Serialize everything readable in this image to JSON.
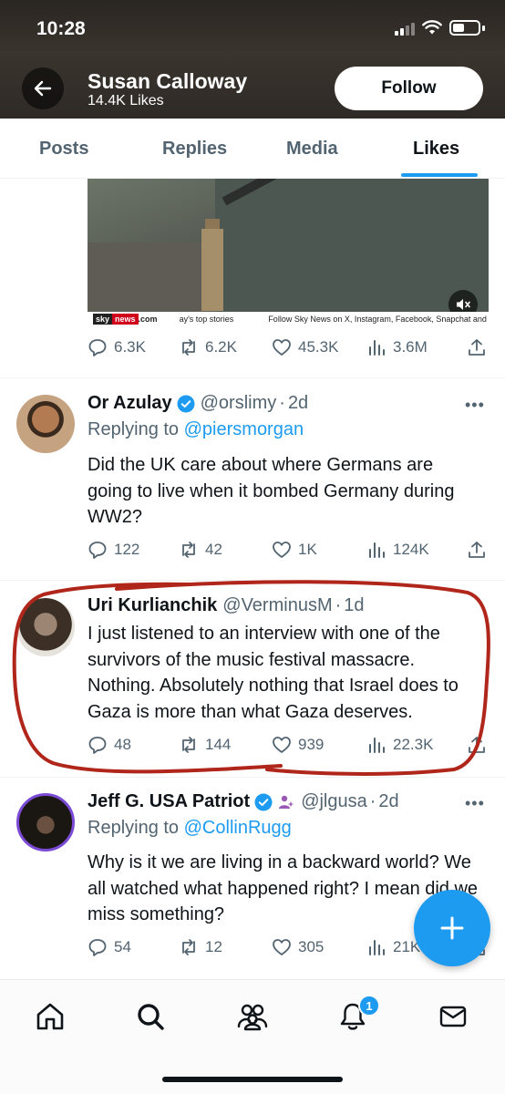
{
  "status_bar": {
    "time": "10:28"
  },
  "header": {
    "name": "Susan Calloway",
    "likes": "14.4K Likes",
    "follow_label": "Follow"
  },
  "tabs": [
    {
      "label": "Posts",
      "active": false
    },
    {
      "label": "Replies",
      "active": false
    },
    {
      "label": "Media",
      "active": false
    },
    {
      "label": "Likes",
      "active": true
    }
  ],
  "media_ticker": {
    "brand_sky": "sky",
    "brand_news": "news",
    "brand_com": ".com",
    "stories": "ay's top stories",
    "follow_text": "Follow Sky News on X, Instagram, Facebook, Snapchat and T"
  },
  "post0": {
    "stats": {
      "replies": "6.3K",
      "reposts": "6.2K",
      "likes": "45.3K",
      "views": "3.6M"
    }
  },
  "post1": {
    "name": "Or Azulay",
    "handle": "@orslimy",
    "dot": "·",
    "age": "2d",
    "replying_prefix": "Replying to",
    "replying_to": "@piersmorgan",
    "text": "Did the UK care about where Germans are going to live when it bombed Germany during WW2?",
    "stats": {
      "replies": "122",
      "reposts": "42",
      "likes": "1K",
      "views": "124K"
    }
  },
  "post2": {
    "name": "Uri Kurlianchik",
    "handle": "@VerminusM",
    "dot": "·",
    "age": "1d",
    "text": "I just listened to an interview with one of the survivors of the music festival massacre. Nothing. Absolutely nothing that Israel does to Gaza is more than what Gaza deserves.",
    "stats": {
      "replies": "48",
      "reposts": "144",
      "likes": "939",
      "views": "22.3K"
    }
  },
  "post3": {
    "name": "Jeff G. USA Patriot",
    "handle": "@jlgusa",
    "dot": "·",
    "age": "2d",
    "replying_prefix": "Replying to",
    "replying_to": "@CollinRugg",
    "text": "Why is it we are living in a backward world? We all watched what happened right? I mean did we miss something?",
    "stats": {
      "replies": "54",
      "reposts": "12",
      "likes": "305",
      "views": "21K"
    }
  },
  "more_glyph": "•••",
  "notifications_badge": "1",
  "colors": {
    "accent": "#1d9bf0",
    "highlight": "#b0261a",
    "muted": "#536471"
  },
  "icons": [
    "back-arrow-icon",
    "home-icon",
    "search-icon",
    "communities-icon",
    "bell-icon",
    "mail-icon",
    "compose-plus-icon",
    "reply-icon",
    "repost-icon",
    "like-icon",
    "views-icon",
    "share-icon",
    "verified-icon",
    "mute-icon"
  ]
}
